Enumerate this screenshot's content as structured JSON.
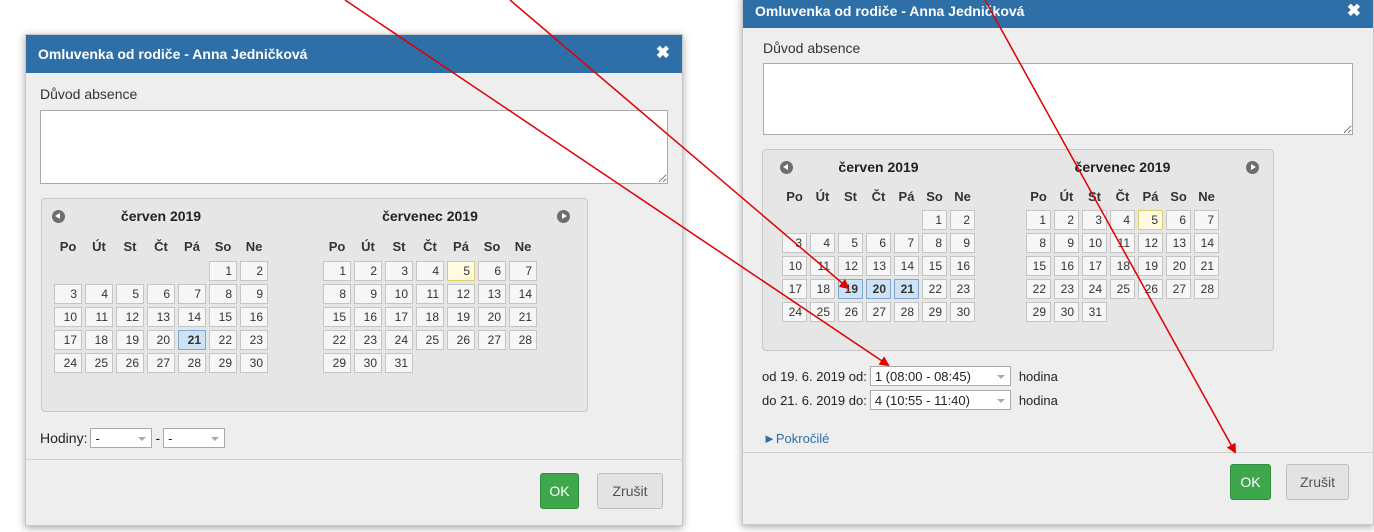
{
  "dialog_left": {
    "title": "Omluvenka od rodiče - Anna Jedničková",
    "close_glyph": "✖",
    "reason_label": "Důvod absence",
    "reason_value": "",
    "calendar": {
      "june": {
        "title": "červen 2019",
        "weekdays": [
          "Po",
          "Út",
          "St",
          "Čt",
          "Pá",
          "So",
          "Ne"
        ],
        "weeks": [
          [
            "",
            "",
            "",
            "",
            "",
            "1",
            "2"
          ],
          [
            "3",
            "4",
            "5",
            "6",
            "7",
            "8",
            "9"
          ],
          [
            "10",
            "11",
            "12",
            "13",
            "14",
            "15",
            "16"
          ],
          [
            "17",
            "18",
            "19",
            "20",
            "21",
            "22",
            "23"
          ],
          [
            "24",
            "25",
            "26",
            "27",
            "28",
            "29",
            "30"
          ]
        ],
        "selected": [
          "21"
        ],
        "today": []
      },
      "july": {
        "title": "červenec 2019",
        "weekdays": [
          "Po",
          "Út",
          "St",
          "Čt",
          "Pá",
          "So",
          "Ne"
        ],
        "weeks": [
          [
            "1",
            "2",
            "3",
            "4",
            "5",
            "6",
            "7"
          ],
          [
            "8",
            "9",
            "10",
            "11",
            "12",
            "13",
            "14"
          ],
          [
            "15",
            "16",
            "17",
            "18",
            "19",
            "20",
            "21"
          ],
          [
            "22",
            "23",
            "24",
            "25",
            "26",
            "27",
            "28"
          ],
          [
            "29",
            "30",
            "31",
            "",
            "",
            "",
            ""
          ]
        ],
        "selected": [],
        "today": [
          "5"
        ]
      }
    },
    "hours_label": "Hodiny:",
    "hours_from": "-",
    "hours_sep": "-",
    "hours_to": "-",
    "ok_label": "OK",
    "cancel_label": "Zrušit"
  },
  "dialog_right": {
    "title": "Omluvenka od rodiče - Anna Jedničková",
    "close_glyph": "✖",
    "reason_label": "Důvod absence",
    "reason_value": "",
    "calendar": {
      "june": {
        "title": "červen 2019",
        "weekdays": [
          "Po",
          "Út",
          "St",
          "Čt",
          "Pá",
          "So",
          "Ne"
        ],
        "weeks": [
          [
            "",
            "",
            "",
            "",
            "",
            "1",
            "2"
          ],
          [
            "3",
            "4",
            "5",
            "6",
            "7",
            "8",
            "9"
          ],
          [
            "10",
            "11",
            "12",
            "13",
            "14",
            "15",
            "16"
          ],
          [
            "17",
            "18",
            "19",
            "20",
            "21",
            "22",
            "23"
          ],
          [
            "24",
            "25",
            "26",
            "27",
            "28",
            "29",
            "30"
          ]
        ],
        "selected": [
          "19",
          "20",
          "21"
        ],
        "today": []
      },
      "july": {
        "title": "červenec 2019",
        "weekdays": [
          "Po",
          "Út",
          "St",
          "Čt",
          "Pá",
          "So",
          "Ne"
        ],
        "weeks": [
          [
            "1",
            "2",
            "3",
            "4",
            "5",
            "6",
            "7"
          ],
          [
            "8",
            "9",
            "10",
            "11",
            "12",
            "13",
            "14"
          ],
          [
            "15",
            "16",
            "17",
            "18",
            "19",
            "20",
            "21"
          ],
          [
            "22",
            "23",
            "24",
            "25",
            "26",
            "27",
            "28"
          ],
          [
            "29",
            "30",
            "31",
            "",
            "",
            "",
            ""
          ]
        ],
        "selected": [],
        "today": [
          "5"
        ]
      }
    },
    "from_label": "od 19. 6. 2019 od:",
    "from_value": "1 (08:00 - 08:45)",
    "from_unit": "hodina",
    "to_label": "do 21. 6. 2019 do:",
    "to_value": "4 (10:55 - 11:40)",
    "to_unit": "hodina",
    "advanced_label": "►Pokročilé",
    "ok_label": "OK",
    "cancel_label": "Zrušit"
  },
  "colors": {
    "titlebar": "#2e6fa7",
    "ok_button": "#3ea64b",
    "arrow": "#e00000",
    "selected_day": "#cde2f4"
  }
}
